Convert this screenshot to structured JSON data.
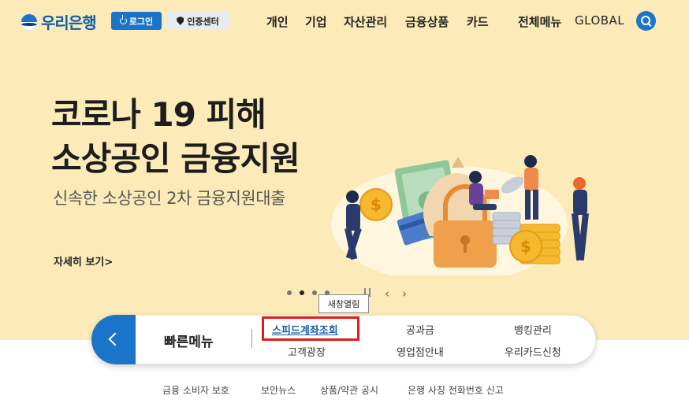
{
  "header": {
    "logo_text": "우리은행",
    "login_label": "로그인",
    "cert_label": "인증센터",
    "gnb": [
      "개인",
      "기업",
      "자산관리",
      "금융상품",
      "카드"
    ],
    "all_menu_label": "전체메뉴",
    "global_label": "GLOBAL",
    "search_icon": "search-icon"
  },
  "hero": {
    "title_line1": "코로나 19 피해",
    "title_line2": "소상공인 금융지원",
    "subtitle": "신속한 소상공인 2차 금융지원대출",
    "more_label": "자세히 보기>",
    "slide_count": 4,
    "active_slide": 2
  },
  "tooltip": "새창열림",
  "quick_menu": {
    "title": "빠른메뉴",
    "links": [
      "스피드계좌조회",
      "공과금",
      "뱅킹관리",
      "고객광장",
      "영업점안내",
      "우리카드신청"
    ]
  },
  "footer_links": [
    "금융 소비자 보호",
    "보안뉴스",
    "상품/약관 공시",
    "은행 사칭 전화번호 신고"
  ],
  "colors": {
    "brand_blue": "#1a74c9",
    "hero_bg": "#fcebb8",
    "highlight_red": "#e01b1b"
  }
}
